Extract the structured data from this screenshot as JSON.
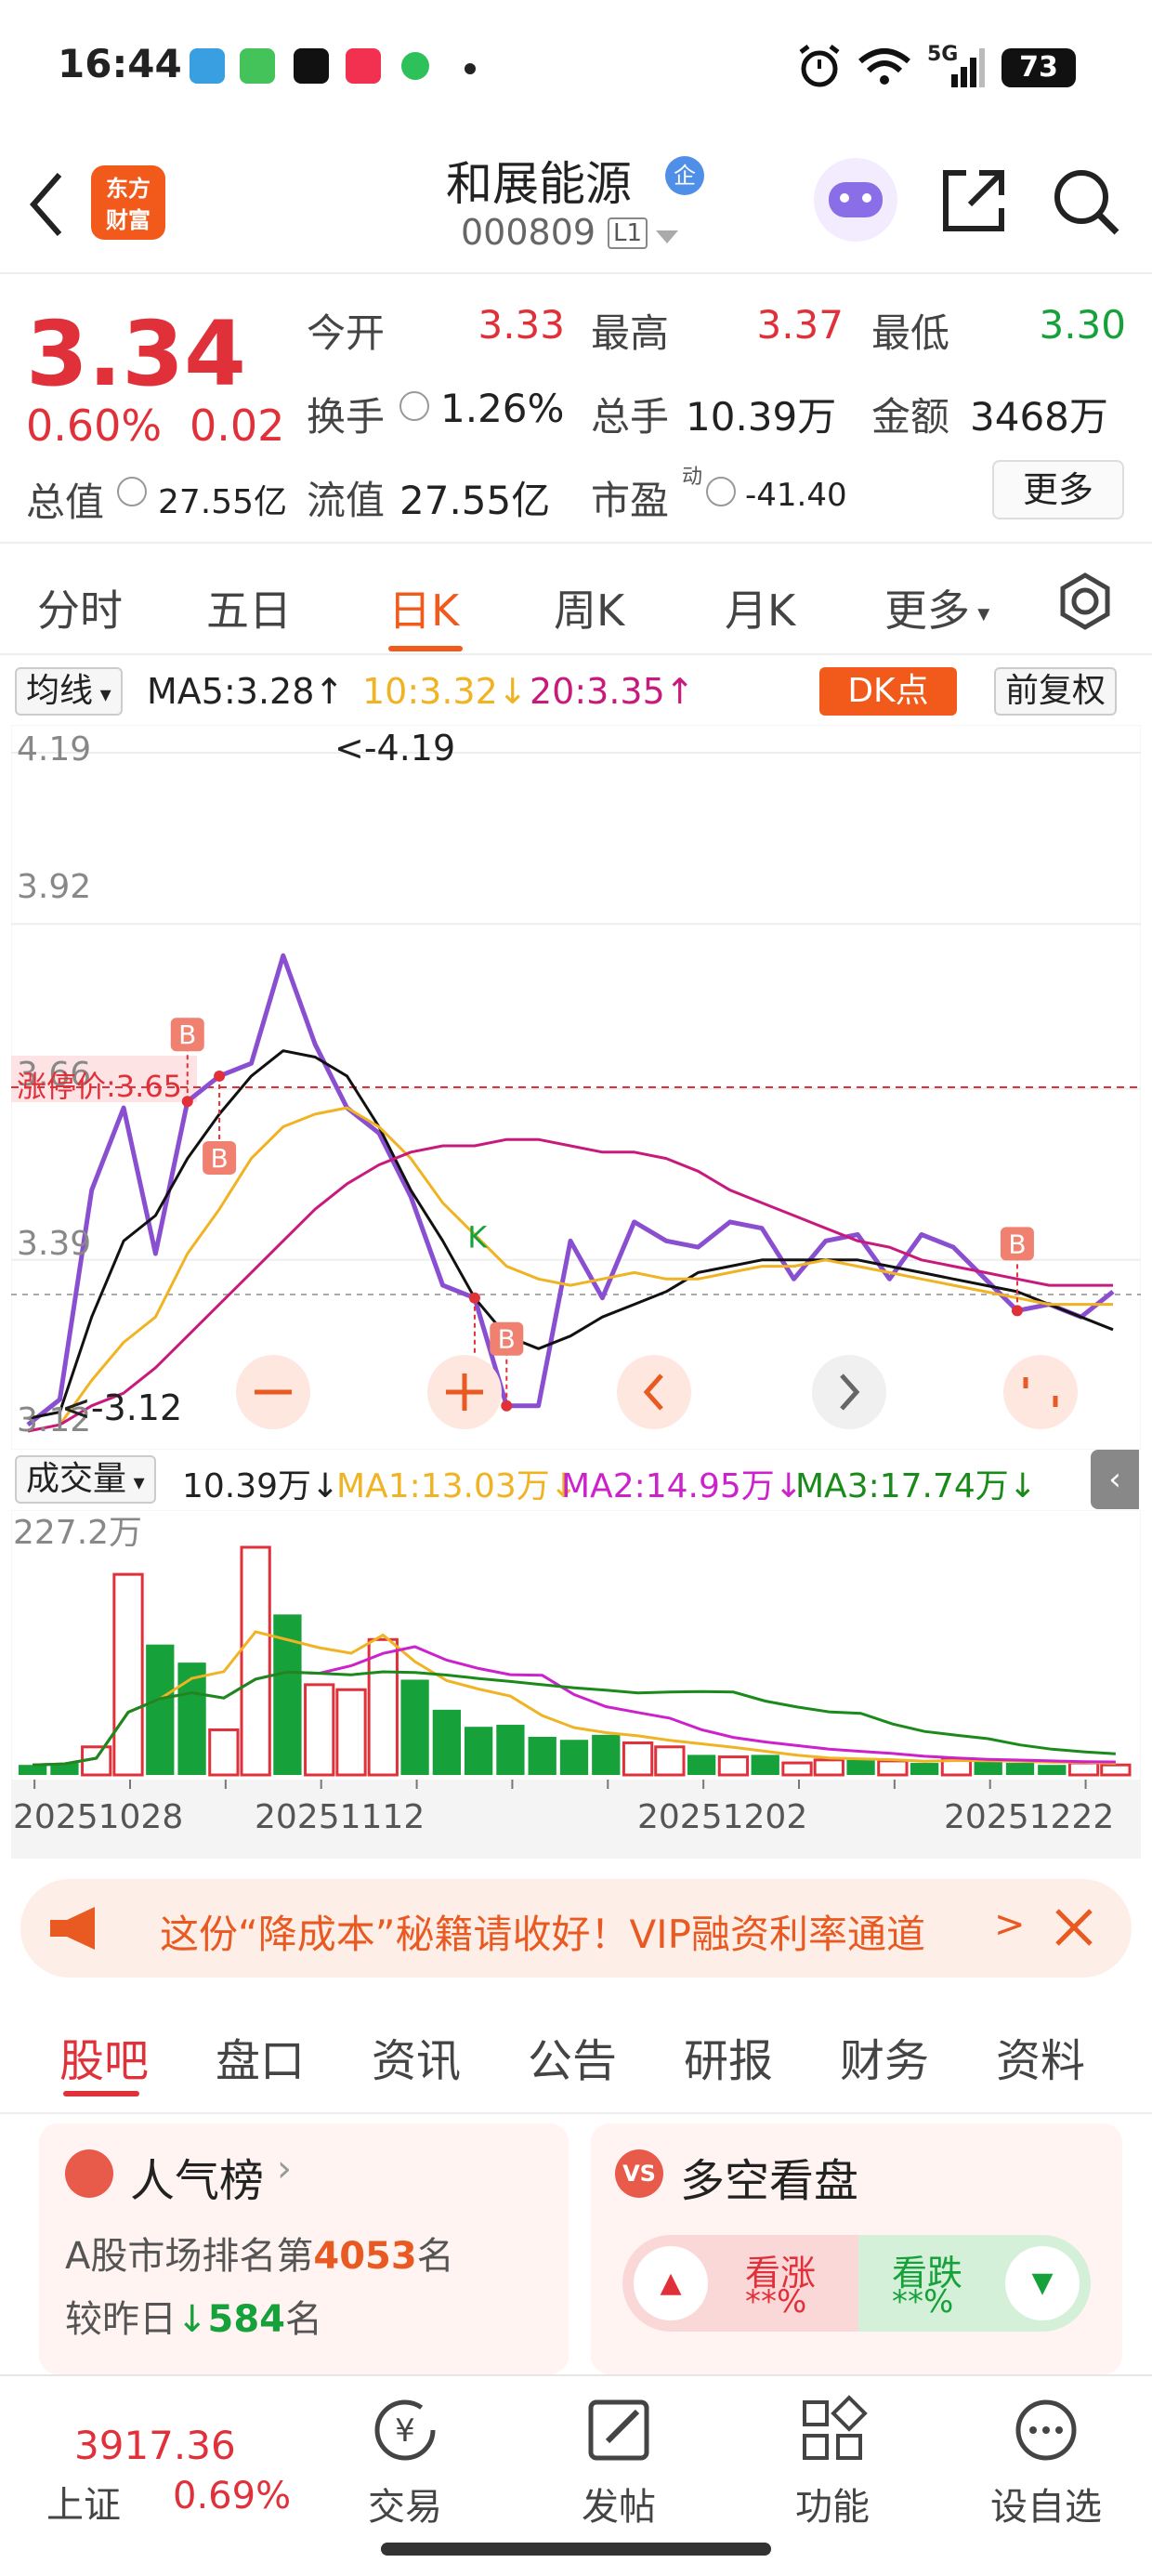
{
  "status_bar": {
    "time": "16:44",
    "network": "5G",
    "battery": "73",
    "icons": [
      "telegram-icon",
      "wechat-mini-icon",
      "tiktok-icon",
      "xiaohongshu-icon",
      "chat-icon",
      "dot-icon"
    ],
    "right_icons": [
      "alarm-icon",
      "wifi-icon",
      "signal-icon"
    ]
  },
  "header": {
    "logo_line1": "东方",
    "logo_line2": "财富",
    "stock_name": "和展能源",
    "enterprise_badge": "企",
    "stock_code": "000809",
    "level": "L1"
  },
  "quote": {
    "price": "3.34",
    "change_pct": "0.60%",
    "change_amt": "0.02",
    "open_label": "今开",
    "open": "3.33",
    "high_label": "最高",
    "high": "3.37",
    "low_label": "最低",
    "low": "3.30",
    "turnover_label": "换手",
    "turnover": "1.26%",
    "volume_label": "总手",
    "volume": "10.39万",
    "amount_label": "金额",
    "amount": "3468万",
    "mktcap_label": "总值",
    "mktcap": "27.55亿",
    "float_label": "流值",
    "float_cap": "27.55亿",
    "pe_label": "市盈",
    "pe_sup": "动",
    "pe": "-41.40",
    "more_label": "更多"
  },
  "chart_tabs": [
    "分时",
    "五日",
    "日K",
    "周K",
    "月K",
    "更多"
  ],
  "active_chart_tab": "日K",
  "ma_legend": {
    "selector": "均线",
    "ma5": "MA5:3.28↑",
    "ma10": "10:3.32↓",
    "ma20": "20:3.35↑",
    "dk_label": "DK点",
    "adjust_label": "前复权"
  },
  "colors": {
    "accent": "#f25a1c",
    "up": "#e0313a",
    "down": "#17a13a",
    "price_line": "#8a4fd1",
    "ma5": "#111111",
    "ma10": "#f0b323",
    "ma20": "#c8197d",
    "vol_ma1": "#f0b323",
    "vol_ma2": "#cc22cc",
    "vol_ma3": "#1a8a1a"
  },
  "kline": {
    "price_labels": [
      "4.19",
      "3.92",
      "3.66",
      "3.39",
      "3.12"
    ],
    "limit_up_label": "涨停价:3.65",
    "max_marker": "<-4.19",
    "min_marker": "<-3.12",
    "k_marker": "K",
    "b_marker": "B",
    "controls": [
      "minus-icon",
      "plus-icon",
      "left-icon",
      "right-icon",
      "expand-icon"
    ]
  },
  "chart_data": {
    "type": "line",
    "ylim": [
      3.12,
      4.19
    ],
    "series": [
      {
        "values": [
          3.13,
          3.17,
          3.5,
          3.63,
          3.4,
          3.64,
          3.68,
          3.7,
          3.87,
          3.73,
          3.63,
          3.59,
          3.49,
          3.35,
          3.33,
          3.16,
          3.16,
          3.42,
          3.33,
          3.45,
          3.42,
          3.41,
          3.45,
          3.44,
          3.36,
          3.42,
          3.43,
          3.36,
          3.43,
          3.41,
          3.36,
          3.31,
          3.32,
          3.3,
          3.34
        ]
      },
      {
        "values": [
          3.14,
          3.15,
          3.3,
          3.42,
          3.46,
          3.55,
          3.62,
          3.68,
          3.72,
          3.71,
          3.68,
          3.6,
          3.5,
          3.42,
          3.33,
          3.27,
          3.25,
          3.27,
          3.3,
          3.32,
          3.34,
          3.37,
          3.38,
          3.39,
          3.39,
          3.39,
          3.39,
          3.38,
          3.37,
          3.36,
          3.35,
          3.34,
          3.32,
          3.3,
          3.28
        ]
      },
      {
        "values": [
          3.12,
          3.13,
          3.2,
          3.26,
          3.3,
          3.4,
          3.47,
          3.55,
          3.6,
          3.62,
          3.63,
          3.6,
          3.55,
          3.48,
          3.43,
          3.38,
          3.36,
          3.35,
          3.36,
          3.37,
          3.36,
          3.36,
          3.37,
          3.38,
          3.38,
          3.39,
          3.38,
          3.37,
          3.36,
          3.35,
          3.34,
          3.33,
          3.32,
          3.32,
          3.32
        ]
      },
      {
        "values": [
          3.12,
          3.13,
          3.16,
          3.18,
          3.22,
          3.27,
          3.32,
          3.37,
          3.42,
          3.47,
          3.51,
          3.54,
          3.56,
          3.57,
          3.57,
          3.58,
          3.58,
          3.57,
          3.56,
          3.56,
          3.55,
          3.53,
          3.5,
          3.48,
          3.46,
          3.44,
          3.42,
          3.41,
          3.39,
          3.38,
          3.37,
          3.36,
          3.35,
          3.35,
          3.35
        ]
      }
    ],
    "b_points": [
      5,
      6,
      14,
      15,
      31
    ],
    "k_point": 15
  },
  "volume": {
    "selector": "成交量",
    "current": "10.39万↓",
    "ma1": "MA1:13.03万↓",
    "ma2": "MA2:14.95万↓",
    "ma3": "MA3:17.74万↓",
    "max_label": "227.2万",
    "dates": [
      "20251028",
      "20251112",
      "20251202",
      "20251222"
    ],
    "bars": [
      {
        "v": 10,
        "up": false
      },
      {
        "v": 12,
        "up": false
      },
      {
        "v": 28,
        "up": true
      },
      {
        "v": 200,
        "up": true
      },
      {
        "v": 130,
        "up": false
      },
      {
        "v": 112,
        "up": false
      },
      {
        "v": 45,
        "up": true
      },
      {
        "v": 227,
        "up": true
      },
      {
        "v": 160,
        "up": false
      },
      {
        "v": 90,
        "up": true
      },
      {
        "v": 85,
        "up": true
      },
      {
        "v": 135,
        "up": true
      },
      {
        "v": 95,
        "up": false
      },
      {
        "v": 65,
        "up": false
      },
      {
        "v": 48,
        "up": false
      },
      {
        "v": 50,
        "up": false
      },
      {
        "v": 38,
        "up": false
      },
      {
        "v": 35,
        "up": false
      },
      {
        "v": 40,
        "up": false
      },
      {
        "v": 32,
        "up": true
      },
      {
        "v": 28,
        "up": true
      },
      {
        "v": 20,
        "up": false
      },
      {
        "v": 18,
        "up": true
      },
      {
        "v": 20,
        "up": false
      },
      {
        "v": 12,
        "up": true
      },
      {
        "v": 15,
        "up": true
      },
      {
        "v": 15,
        "up": false
      },
      {
        "v": 14,
        "up": true
      },
      {
        "v": 12,
        "up": false
      },
      {
        "v": 16,
        "up": true
      },
      {
        "v": 14,
        "up": false
      },
      {
        "v": 12,
        "up": false
      },
      {
        "v": 10,
        "up": false
      },
      {
        "v": 12,
        "up": true
      },
      {
        "v": 10,
        "up": true
      }
    ]
  },
  "ad": {
    "text": "这份“降成本”秘籍请收好！VIP融资利率通道",
    "arrow": ">"
  },
  "news_tabs": [
    "股吧",
    "盘口",
    "资讯",
    "公告",
    "研报",
    "财务",
    "资料"
  ],
  "active_news_tab": "股吧",
  "popularity": {
    "title": "人气榜",
    "rank_prefix": "A股市场排名第",
    "rank": "4053",
    "rank_suffix": "名",
    "change_prefix": "较昨日",
    "change": "584",
    "change_suffix": "名"
  },
  "long_short": {
    "title": "多空看盘",
    "bull_label": "看涨",
    "bull_value": "**%",
    "bear_label": "看跌",
    "bear_value": "**%"
  },
  "bottom_nav": {
    "index_value": "3917.36",
    "index_name": "上证",
    "index_change": "0.69%",
    "items": [
      "交易",
      "发帖",
      "功能",
      "设自选"
    ]
  }
}
